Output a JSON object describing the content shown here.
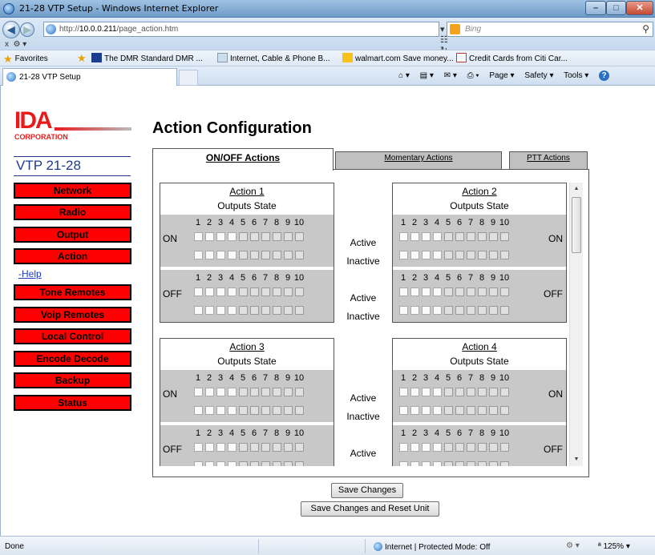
{
  "browser": {
    "window_title": "21-28 VTP Setup - Windows Internet Explorer",
    "address_url_prefix": "http://",
    "address_url_host": "10.0.0.211",
    "address_url_path": "/page_action.htm",
    "search_placeholder": "Bing",
    "favorites_label": "Favorites",
    "favorites": [
      "The DMR Standard DMR ...",
      "Internet, Cable & Phone B...",
      "walmart.com Save money...",
      "Credit Cards from Citi Car..."
    ],
    "tab_title": "21-28 VTP Setup",
    "command_bar": {
      "page": "Page ▾",
      "safety": "Safety ▾",
      "tools": "Tools ▾"
    },
    "status_done": "Done",
    "status_zone": "Internet | Protected Mode: Off",
    "zoom": "ª 125%  ▾"
  },
  "logo": {
    "text": "IDA",
    "corp": "CORPORATION"
  },
  "model": "VTP 21-28",
  "nav": {
    "items": [
      "Network",
      "Radio",
      "Output",
      "Action",
      "Tone Remotes",
      "Voip Remotes",
      "Local Control",
      "Encode Decode",
      "Backup",
      "Status"
    ],
    "help_link": "-Help"
  },
  "page_title": "Action Configuration",
  "tabs": {
    "onoff": "ON/OFF Actions",
    "momentary": "Momentary Actions",
    "ptt": "PTT Actions"
  },
  "actions": [
    {
      "title": "Action 1",
      "subtitle": "Outputs State",
      "on_label": "ON",
      "off_label": "OFF"
    },
    {
      "title": "Action 2",
      "subtitle": "Outputs State",
      "on_label": "ON",
      "off_label": "OFF"
    },
    {
      "title": "Action 3",
      "subtitle": "Outputs State",
      "on_label": "ON",
      "off_label": "OFF"
    },
    {
      "title": "Action 4",
      "subtitle": "Outputs State",
      "on_label": "ON",
      "off_label": "OFF"
    }
  ],
  "output_numbers": [
    "1",
    "2",
    "3",
    "4",
    "5",
    "6",
    "7",
    "8",
    "9",
    "10"
  ],
  "state_labels": {
    "active": "Active",
    "inactive": "Inactive"
  },
  "buttons": {
    "save": "Save Changes",
    "save_reset": "Save Changes and Reset Unit"
  }
}
